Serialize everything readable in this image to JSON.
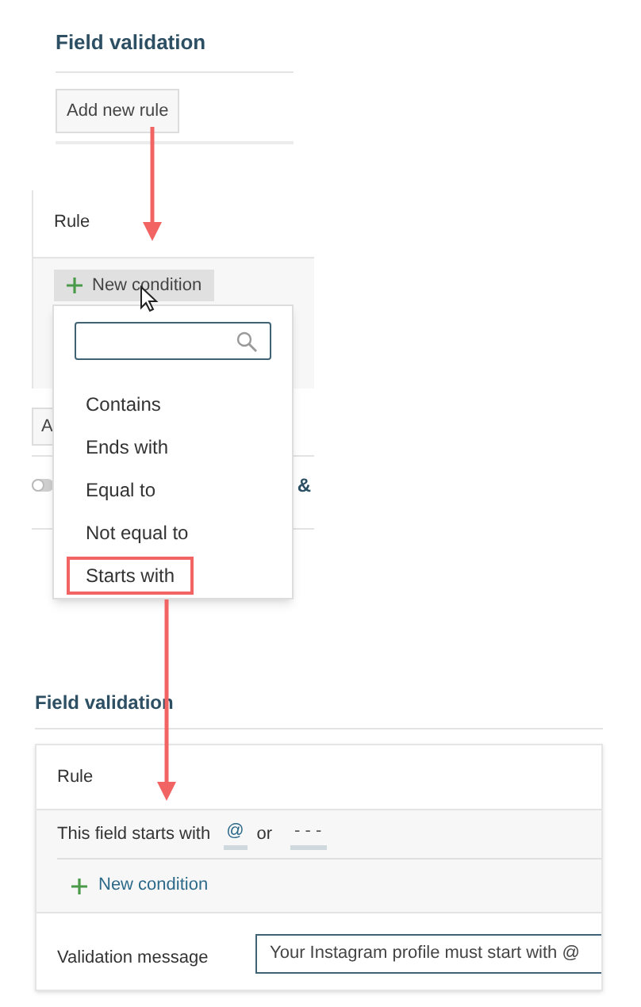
{
  "panel_1": {
    "title": "Field validation",
    "button": "Add new rule"
  },
  "panel_2": {
    "rule_label": "Rule",
    "new_condition_button": "New condition",
    "partial_button": "A",
    "toggle": {
      "on": false
    },
    "partial_text": "&"
  },
  "dropdown": {
    "items": [
      {
        "label": "Contains",
        "highlighted": false
      },
      {
        "label": "Ends with",
        "highlighted": false
      },
      {
        "label": "Equal to",
        "highlighted": false
      },
      {
        "label": "Not equal to",
        "highlighted": false
      },
      {
        "label": "Starts with",
        "highlighted": true
      }
    ]
  },
  "panel_3": {
    "title": "Field validation",
    "rule_label": "Rule",
    "condition": {
      "text": "This field starts with",
      "values": [
        "@",
        "- - -"
      ],
      "joiner": "or"
    },
    "new_condition_button": "New condition",
    "message_label": "Validation message",
    "message_value": "Your Instagram profile must start with @"
  }
}
